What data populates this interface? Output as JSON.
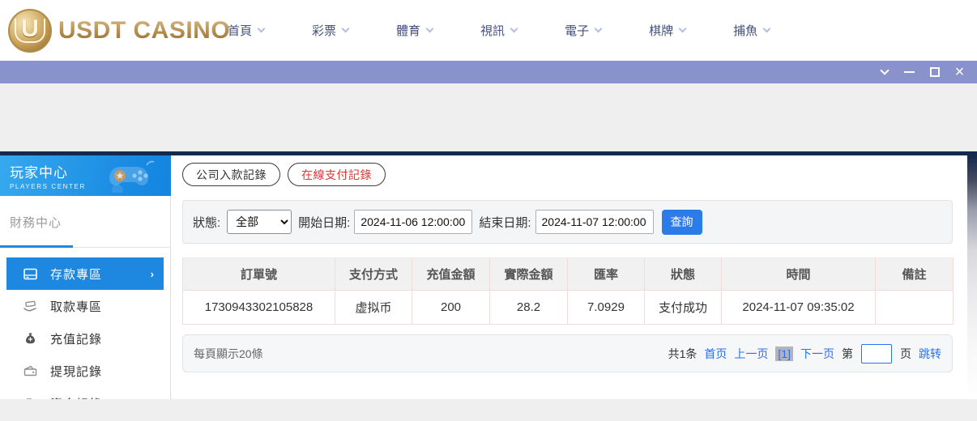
{
  "header": {
    "logo": {
      "badge_letter": "U",
      "text": "USDT CASINO"
    },
    "nav_items": [
      {
        "label": "首頁"
      },
      {
        "label": "彩票"
      },
      {
        "label": "體育"
      },
      {
        "label": "視訊"
      },
      {
        "label": "電子"
      },
      {
        "label": "棋牌"
      },
      {
        "label": "捕魚"
      }
    ]
  },
  "sidebar": {
    "title": "玩家中心",
    "subtitle": "PLAYERS CENTER",
    "section": "財務中心",
    "items": [
      {
        "label": "存款專區",
        "active": true
      },
      {
        "label": "取款專區",
        "active": false
      },
      {
        "label": "充值記錄",
        "active": false
      },
      {
        "label": "提現記錄",
        "active": false
      },
      {
        "label": "資金記錄",
        "active": false
      }
    ]
  },
  "main": {
    "tabs": [
      {
        "label": "公司入款記錄",
        "active": false
      },
      {
        "label": "在線支付記錄",
        "active": true
      }
    ],
    "filters": {
      "status_label": "狀態:",
      "status_value": "全部",
      "start_label": "開始日期:",
      "start_value": "2024-11-06 12:00:00",
      "end_label": "結束日期:",
      "end_value": "2024-11-07 12:00:00",
      "search_button": "查詢"
    },
    "table": {
      "headers": [
        "訂單號",
        "支付方式",
        "充值金額",
        "實際金額",
        "匯率",
        "狀態",
        "時間",
        "備註"
      ],
      "rows": [
        [
          "1730943302105828",
          "虚拟币",
          "200",
          "28.2",
          "7.0929",
          "支付成功",
          "2024-11-07 09:35:02",
          ""
        ]
      ]
    },
    "pagination": {
      "per_page": "每頁顯示20條",
      "total": "共1条",
      "first": "首页",
      "prev": "上一页",
      "current": "[1]",
      "next": "下一页",
      "jump_prefix": "第",
      "jump_suffix": "页",
      "jump_action": "跳转"
    }
  },
  "colors": {
    "titlebar_purple": "#8a92cb",
    "navy_divider": "#14294e",
    "sidebar_active_blue": "#1e87e0",
    "search_button_blue": "#2b7ce9",
    "link_blue": "#2a6ff0",
    "active_tab_red": "#e53333",
    "logo_gold": "#b38c4d",
    "table_grid_pink": "#f2dbdb"
  }
}
